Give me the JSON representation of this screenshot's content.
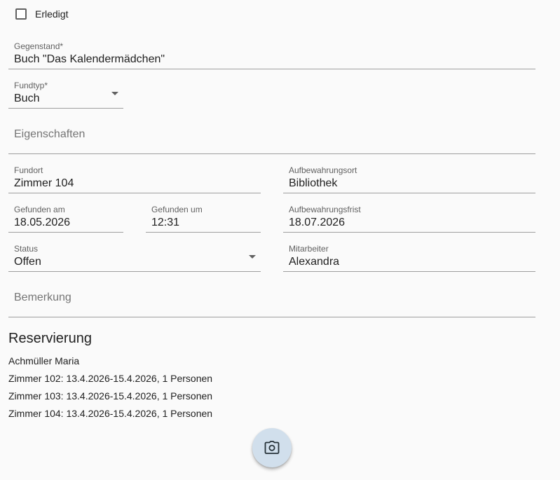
{
  "erledigt": {
    "label": "Erledigt",
    "checked": false
  },
  "gegenstand": {
    "label": "Gegenstand*",
    "value": "Buch \"Das Kalendermädchen\""
  },
  "fundtyp": {
    "label": "Fundtyp*",
    "value": "Buch"
  },
  "eigenschaften": {
    "placeholder": "Eigenschaften"
  },
  "fundort": {
    "label": "Fundort",
    "value": "Zimmer 104"
  },
  "aufbewahrungsort": {
    "label": "Aufbewahrungsort",
    "value": "Bibliothek"
  },
  "gefunden_am": {
    "label": "Gefunden am",
    "value": "18.05.2026"
  },
  "gefunden_um": {
    "label": "Gefunden um",
    "value": "12:31"
  },
  "aufbewahrungsfrist": {
    "label": "Aufbewahrungsfrist",
    "value": "18.07.2026"
  },
  "status": {
    "label": "Status",
    "value": "Offen"
  },
  "mitarbeiter": {
    "label": "Mitarbeiter",
    "value": "Alexandra"
  },
  "bemerkung": {
    "placeholder": "Bemerkung"
  },
  "reservierung": {
    "title": "Reservierung",
    "guest": "Achmüller Maria",
    "rooms": [
      "Zimmer 102: 13.4.2026-15.4.2026, 1 Personen",
      "Zimmer 103: 13.4.2026-15.4.2026, 1 Personen",
      "Zimmer 104: 13.4.2026-15.4.2026, 1 Personen"
    ]
  },
  "fab": {
    "icon": "camera-icon",
    "color": "#d1dfec"
  }
}
